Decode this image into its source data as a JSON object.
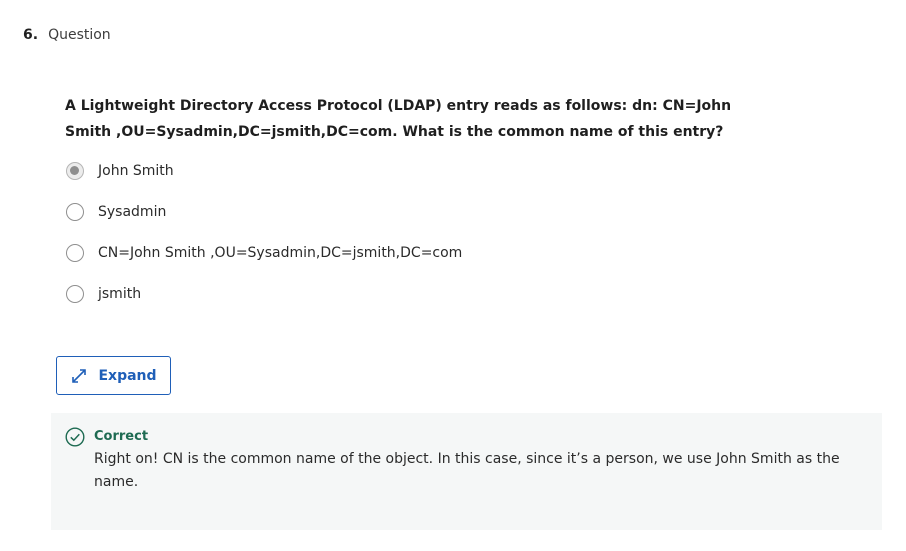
{
  "question": {
    "number": "6.",
    "label": "Question",
    "prompt": "A Lightweight Directory Access Protocol (LDAP) entry reads as follows: dn: CN=John Smith ,OU=Sysadmin,DC=jsmith,DC=com. What is the common name of this entry?"
  },
  "options": [
    {
      "label": "John Smith",
      "selected": true
    },
    {
      "label": "Sysadmin",
      "selected": false
    },
    {
      "label": "CN=John Smith ,OU=Sysadmin,DC=jsmith,DC=com",
      "selected": false
    },
    {
      "label": "jsmith",
      "selected": false
    }
  ],
  "expand_button": {
    "label": "Expand",
    "icon": "expand-arrows-icon"
  },
  "feedback": {
    "icon": "check-circle-icon",
    "title": "Correct",
    "text": "Right on! CN is the common name of the object. In this case, since it’s a person, we use John Smith as the name."
  },
  "colors": {
    "accent": "#1f5fb8",
    "correct": "#1e6b52",
    "feedback_bg": "#f5f7f7"
  }
}
